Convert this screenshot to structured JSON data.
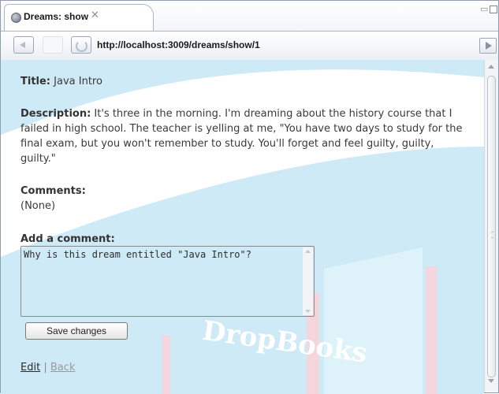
{
  "tab": {
    "title": "Dreams: show",
    "close_glyph": "✕"
  },
  "window": {
    "minimize_glyph": "▭"
  },
  "toolbar": {
    "url": "http://localhost:3009/dreams/show/1",
    "icons": [
      "back-icon",
      "forward-icon",
      "refresh-icon",
      "go-icon"
    ]
  },
  "page": {
    "title_label": "Title:",
    "title_value": "Java Intro",
    "description_label": "Description:",
    "description_value": "It's three in the morning. I'm dreaming about the history course that I failed in high school. The teacher is yelling at me, \"You have two days to study for the final exam, but you won't remember to study. You'll forget and feel guilty, guilty, guilty.\"",
    "comments_label": "Comments:",
    "comments_value": "(None)",
    "add_comment_label": "Add a comment:",
    "comment_text": "Why is this dream entitled \"Java Intro\"?",
    "save_button": "Save changes",
    "edit_link": "Edit",
    "separator": "|",
    "back_link": "Back"
  },
  "watermark": {
    "text": "DropBooks"
  },
  "colors": {
    "watermark_blue": "#cfeaf7",
    "watermark_red": "#f5d6dc",
    "chrome_border": "#a9b6c8"
  }
}
